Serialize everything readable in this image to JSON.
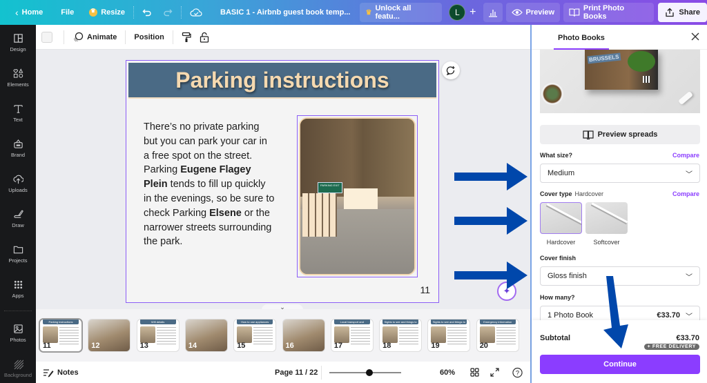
{
  "topbar": {
    "home_label": "Home",
    "file_label": "File",
    "resize_label": "Resize",
    "doc_title": "BASIC 1 - Airbnb guest book temp...",
    "unlock_label": "Unlock all featu...",
    "avatar_initial": "L",
    "preview_label": "Preview",
    "print_label": "Print Photo Books",
    "share_label": "Share"
  },
  "rail": {
    "items": [
      {
        "label": "Design",
        "icon": "layout-icon"
      },
      {
        "label": "Elements",
        "icon": "shapes-icon"
      },
      {
        "label": "Text",
        "icon": "text-icon"
      },
      {
        "label": "Brand",
        "icon": "brand-icon"
      },
      {
        "label": "Uploads",
        "icon": "upload-cloud-icon"
      },
      {
        "label": "Draw",
        "icon": "draw-icon"
      },
      {
        "label": "Projects",
        "icon": "folder-icon"
      },
      {
        "label": "Apps",
        "icon": "apps-grid-icon"
      },
      {
        "label": "Photos",
        "icon": "photo-icon"
      },
      {
        "label": "Background",
        "icon": "background-icon"
      }
    ]
  },
  "editor_toolbar": {
    "animate_label": "Animate",
    "position_label": "Position"
  },
  "slide": {
    "title": "Parking instructions",
    "text_parts": [
      {
        "t": "There’s no private parking but you can park your car in a free spot on the street.",
        "b": false
      },
      {
        "t": "Parking ",
        "b": false
      },
      {
        "t": "Eugene Flagey Plein",
        "b": true
      },
      {
        "t": " tends to fill up quickly in the evenings, so be sure to check Parking ",
        "b": false
      },
      {
        "t": "Elsene",
        "b": true
      },
      {
        "t": " or the narrower streets surrounding the park.",
        "b": false
      }
    ],
    "image_sign": "PARKING EXIT",
    "page_number": "11"
  },
  "thumbnails": [
    {
      "num": "11",
      "title": "Parking instructions",
      "kind": "text",
      "selected": true
    },
    {
      "num": "12",
      "title": "",
      "kind": "photo",
      "selected": false
    },
    {
      "num": "13",
      "title": "Wifi details",
      "kind": "text",
      "selected": false
    },
    {
      "num": "14",
      "title": "",
      "kind": "photo",
      "selected": false
    },
    {
      "num": "15",
      "title": "How to use appliances",
      "kind": "text",
      "selected": false
    },
    {
      "num": "16",
      "title": "",
      "kind": "photo",
      "selected": false
    },
    {
      "num": "17",
      "title": "Local transport and information",
      "kind": "text",
      "selected": false
    },
    {
      "num": "18",
      "title": "Sights to see and things to do",
      "kind": "text",
      "selected": false
    },
    {
      "num": "19",
      "title": "Sights to see and things to do",
      "kind": "text",
      "selected": false
    },
    {
      "num": "20",
      "title": "Emergency information",
      "kind": "text",
      "selected": false
    }
  ],
  "bottombar": {
    "notes_label": "Notes",
    "page_indicator": "Page 11 / 22",
    "zoom_value": 0.6,
    "zoom_label": "60%"
  },
  "panel": {
    "tab_label": "Photo Books",
    "hero_sticker": "BRUSSELS",
    "preview_spreads_label": "Preview spreads",
    "size_label": "What size?",
    "compare_label": "Compare",
    "size_value": "Medium",
    "cover_type_label": "Cover type",
    "cover_type_value": "Hardcover",
    "cover_options": [
      {
        "label": "Hardcover",
        "selected": true
      },
      {
        "label": "Softcover",
        "selected": false
      }
    ],
    "cover_finish_label": "Cover finish",
    "cover_finish_value": "Gloss finish",
    "how_many_label": "How many?",
    "quantity_value": "1 Photo Book",
    "quantity_price": "€33.70",
    "subtotal_label": "Subtotal",
    "subtotal_value": "€33.70",
    "delivery_badge": "+ FREE DELIVERY",
    "continue_label": "Continue"
  },
  "annotations": {
    "arrow_color": "#0047ab",
    "accent_color": "#8b3dff"
  }
}
